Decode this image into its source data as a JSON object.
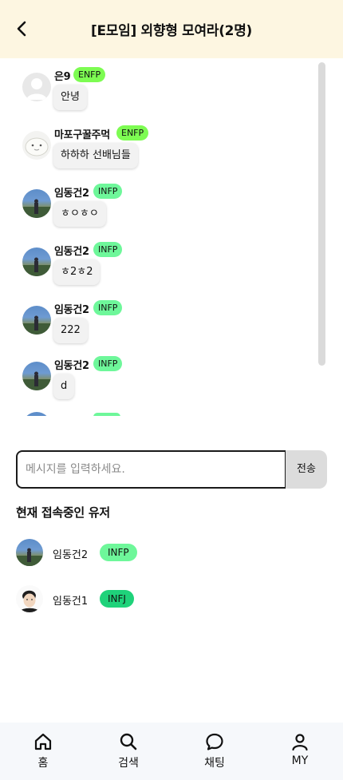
{
  "header": {
    "title": "[E모임] 외향형 모여라(2명)"
  },
  "messages": [
    {
      "nickname": "은9",
      "mbti": "ENFP",
      "text": "안녕"
    },
    {
      "nickname": "마포구꿀주먹",
      "mbti": "ENFP",
      "text": "하하하 선배님들"
    },
    {
      "nickname": "임동건2",
      "mbti": "INFP",
      "text": "ㅎㅇㅎㅇ"
    },
    {
      "nickname": "임동건2",
      "mbti": "INFP",
      "text": "ㅎ2ㅎ2"
    },
    {
      "nickname": "임동건2",
      "mbti": "INFP",
      "text": "222"
    },
    {
      "nickname": "임동건2",
      "mbti": "INFP",
      "text": "d"
    }
  ],
  "composer": {
    "placeholder": "메시지를 입력하세요.",
    "send_label": "전송"
  },
  "online": {
    "title": "현재 접속중인 유저",
    "users": [
      {
        "name": "임동건2",
        "mbti": "INFP"
      },
      {
        "name": "임동건1",
        "mbti": "INFJ"
      }
    ]
  },
  "tabs": [
    {
      "label": "홈",
      "icon": "home-icon"
    },
    {
      "label": "검색",
      "icon": "search-icon"
    },
    {
      "label": "채팅",
      "icon": "chat-icon"
    },
    {
      "label": "MY",
      "icon": "user-icon"
    }
  ],
  "colors": {
    "header_bg": "#fdf6e1",
    "badge_enfp": "#7dfc52",
    "badge_infp": "#6ef79a",
    "badge_infj": "#1fd27a",
    "tabbar_bg": "#f6f8fb"
  }
}
